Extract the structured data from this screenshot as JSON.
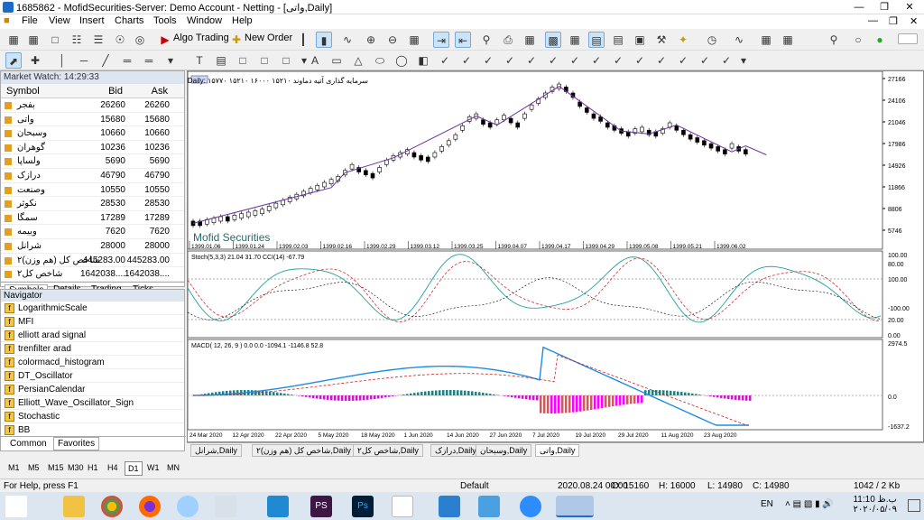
{
  "window": {
    "title": "1685862 - MofidSecurities-Server: Demo Account - Netting - [واتی,Daily]"
  },
  "menu": [
    "File",
    "View",
    "Insert",
    "Charts",
    "Tools",
    "Window",
    "Help"
  ],
  "toolbar": {
    "algo_trading": "Algo Trading",
    "new_order": "New Order"
  },
  "market_watch": {
    "header": "Market Watch: 14:29:33",
    "columns": {
      "symbol": "Symbol",
      "bid": "Bid",
      "ask": "Ask"
    },
    "rows": [
      {
        "symbol": "بفجر",
        "bid": "26260",
        "ask": "26260"
      },
      {
        "symbol": "واتی",
        "bid": "15680",
        "ask": "15680"
      },
      {
        "symbol": "وسبحان",
        "bid": "10660",
        "ask": "10660"
      },
      {
        "symbol": "گوهران",
        "bid": "10236",
        "ask": "10236"
      },
      {
        "symbol": "ولساپا",
        "bid": "5690",
        "ask": "5690"
      },
      {
        "symbol": "درازک",
        "bid": "46790",
        "ask": "46790"
      },
      {
        "symbol": "وصنعت",
        "bid": "10550",
        "ask": "10550"
      },
      {
        "symbol": "نکوثر",
        "bid": "28530",
        "ask": "28530"
      },
      {
        "symbol": "سمگا",
        "bid": "17289",
        "ask": "17289"
      },
      {
        "symbol": "وبیمه",
        "bid": "7620",
        "ask": "7620"
      },
      {
        "symbol": "شرانل",
        "bid": "28000",
        "ask": "28000"
      },
      {
        "symbol": "شاخص کل (هم وزن)۲",
        "bid": "445283.00",
        "ask": "445283.00"
      },
      {
        "symbol": "شاخص کل۲",
        "bid": "1642038....",
        "ask": "1642038...."
      }
    ],
    "tabs": [
      "Symbols",
      "Details",
      "Trading",
      "Ticks"
    ]
  },
  "navigator": {
    "header": "Navigator",
    "items": [
      "LogarithmicScale",
      "MFI",
      "elliott arad signal",
      "trenfilter arad",
      "colormacd_histogram",
      "DT_Oscillator",
      "PersianCalendar",
      "Elliott_Wave_Oscillator_Sign",
      "Stochastic",
      "BB"
    ],
    "tabs": [
      "Common",
      "Favorites"
    ]
  },
  "timeframes": [
    "M1",
    "M5",
    "M15",
    "M30",
    "H1",
    "H4",
    "D1",
    "W1",
    "MN"
  ],
  "selected_timeframe": "D1",
  "chart": {
    "header": "واتی, Daily: ۱۵۷۷۰ ۱۵۲۱۰ ۱۶۰۰۰ ۱۵۲۱۰ سرمایه گذاری آتیه دماوند",
    "watermark": "Mofid Securities",
    "price_ticks": [
      "27166",
      "24106",
      "21046",
      "17986",
      "14926",
      "11866",
      "8806",
      "5746"
    ],
    "shamsi_dates": [
      "1399.01.06",
      "1399.01.24",
      "1399.02.03",
      "1399.02.16",
      "1399.02.29",
      "1399.03.12",
      "1399.03.25",
      "1399.04.07",
      "1399.04.17",
      "1399.04.29",
      "1399.05.08",
      "1399.05.21",
      "1399.06.02"
    ],
    "stoch_label": "Stoch(5,3,3) 21.04 31.70 CCI(14) -67.79",
    "stoch_ticks": [
      "100.00",
      "80.00",
      "100.00",
      "-100.00",
      "20.00",
      "0.00"
    ],
    "macd_label": "MACD( 12, 26, 9 ) 0.0 0.0 -1094.1 -1146.8 52.8",
    "macd_ticks": [
      "2974.5",
      "0.0",
      "-1637.2"
    ],
    "greg_dates": [
      "24 Mar 2020",
      "12 Apr 2020",
      "22 Apr 2020",
      "5 May 2020",
      "18 May 2020",
      "1 Jun 2020",
      "14 Jun 2020",
      "27 Jun 2020",
      "7 Jul 2020",
      "19 Jul 2020",
      "29 Jul 2020",
      "11 Aug 2020",
      "23 Aug 2020"
    ]
  },
  "chart_tabs": [
    "شرانل,Daily",
    "شاخص کل (هم وزن)۲,Daily",
    "شاخص کل۲,Daily",
    "درازک,Daily",
    "وسبحان,Daily",
    "واتی,Daily"
  ],
  "status": {
    "help": "For Help, press F1",
    "profile": "Default",
    "datetime": "2020.08.24 00:00",
    "open": "O: 15160",
    "high": "H: 16000",
    "low": "L: 14980",
    "close": "C: 14980",
    "traffic": "1042 / 2 Kb"
  },
  "taskbar": {
    "lang": "EN",
    "time": "11:10 ب.ظ",
    "date": "۲۰۲۰/۰۵/۰۹"
  }
}
